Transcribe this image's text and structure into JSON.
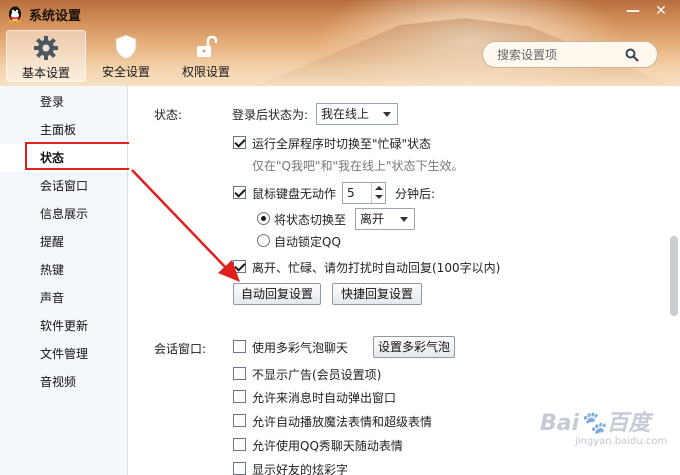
{
  "window": {
    "title": "系统设置",
    "minimize": "—",
    "close": "✕"
  },
  "top_tabs": [
    {
      "label": "基本设置",
      "icon": "gear-icon",
      "active": true
    },
    {
      "label": "安全设置",
      "icon": "shield-icon",
      "active": false
    },
    {
      "label": "权限设置",
      "icon": "unlock-icon",
      "active": false
    }
  ],
  "search": {
    "placeholder": "搜索设置项"
  },
  "sidebar": {
    "items": [
      {
        "label": "登录"
      },
      {
        "label": "主面板"
      },
      {
        "label": "状态",
        "active": true
      },
      {
        "label": "会话窗口"
      },
      {
        "label": "信息展示"
      },
      {
        "label": "提醒"
      },
      {
        "label": "热键"
      },
      {
        "label": "声音"
      },
      {
        "label": "软件更新"
      },
      {
        "label": "文件管理"
      },
      {
        "label": "音视频"
      }
    ]
  },
  "status_section": {
    "label": "状态:",
    "after_login_label": "登录后状态为:",
    "after_login_value": "我在线上",
    "fullscreen_busy": {
      "label": "运行全屏程序时切换至\"忙碌\"状态",
      "checked": true
    },
    "fullscreen_hint": "仅在\"Q我吧\"和\"我在线上\"状态下生效。",
    "idle": {
      "label": "鼠标键盘无动作",
      "checked": true,
      "minutes": "5",
      "suffix": "分钟后:"
    },
    "idle_switch": {
      "label": "将状态切换至",
      "checked": true,
      "value": "离开"
    },
    "idle_lock": {
      "label": "自动锁定QQ",
      "checked": false
    },
    "auto_reply": {
      "label": "离开、忙碌、请勿打扰时自动回复(100字以内)",
      "checked": true
    },
    "auto_reply_btn": "自动回复设置",
    "quick_reply_btn": "快捷回复设置"
  },
  "chat_section": {
    "label": "会话窗口:",
    "options": [
      {
        "label": "使用多彩气泡聊天",
        "checked": false
      },
      {
        "label": "不显示广告(会员设置项)",
        "checked": false
      },
      {
        "label": "允许来消息时自动弹出窗口",
        "checked": false
      },
      {
        "label": "允许自动播放魔法表情和超级表情",
        "checked": false
      },
      {
        "label": "允许使用QQ秀聊天随动表情",
        "checked": false
      },
      {
        "label": "显示好友的炫彩字",
        "checked": false
      }
    ],
    "bubble_btn": "设置多彩气泡"
  },
  "annotation": {
    "color": "#e01f1f"
  },
  "watermark": {
    "text": "Bai🐾百度",
    "sub": "jingyan.baidu.com"
  }
}
